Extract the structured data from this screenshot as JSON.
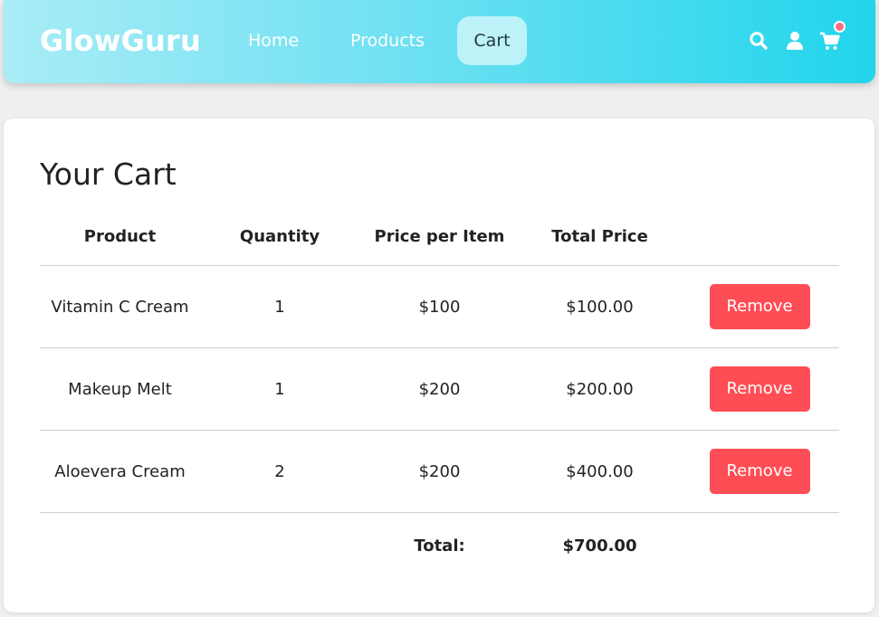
{
  "nav": {
    "brand": "GlowGuru",
    "links": [
      {
        "label": "Home"
      },
      {
        "label": "Products"
      },
      {
        "label": "Cart"
      }
    ],
    "active": "Cart",
    "icons": [
      "search-icon",
      "user-icon",
      "cart-icon"
    ],
    "cart_badge_color": "#ff6b83"
  },
  "cart": {
    "title": "Your Cart",
    "headers": {
      "product": "Product",
      "quantity": "Quantity",
      "price": "Price per Item",
      "total": "Total Price"
    },
    "rows": [
      {
        "product": "Vitamin C Cream",
        "quantity": "1",
        "price": "$100",
        "total": "$100.00",
        "action": "Remove"
      },
      {
        "product": "Makeup Melt",
        "quantity": "1",
        "price": "$200",
        "total": "$200.00",
        "action": "Remove"
      },
      {
        "product": "Aloevera Cream",
        "quantity": "2",
        "price": "$200",
        "total": "$400.00",
        "action": "Remove"
      }
    ],
    "total_label": "Total:",
    "grand_total": "$700.00"
  },
  "colors": {
    "remove_button": "#ff4d55",
    "nav_gradient_start": "#a9ecf6",
    "nav_gradient_end": "#21d5ec",
    "active_tab": "#bdf2f9"
  }
}
